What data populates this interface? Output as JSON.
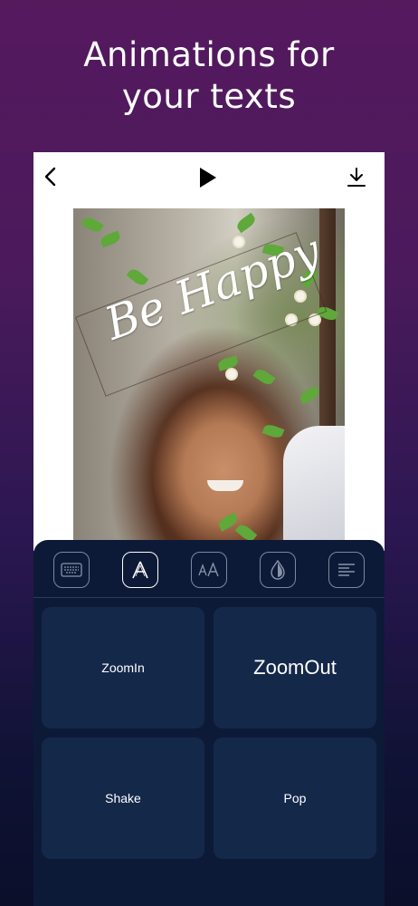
{
  "headline": {
    "line1": "Animations for",
    "line2": "your texts"
  },
  "topbar": {
    "icons": [
      "back-icon",
      "play-icon",
      "download-icon"
    ]
  },
  "canvas": {
    "text": "Be Happy"
  },
  "toolbar": {
    "tools": [
      "keyboard-icon",
      "animation-icon",
      "font-size-icon",
      "color-drop-icon",
      "align-icon"
    ],
    "active": "animation-icon"
  },
  "animations": {
    "items": [
      {
        "label": "ZoomIn"
      },
      {
        "label": "ZoomOut"
      },
      {
        "label": "Shake"
      },
      {
        "label": "Pop"
      }
    ],
    "selected": "ZoomOut"
  },
  "colors": {
    "panel": "#0d1a37",
    "tile": "#14284a",
    "accent": "#ffffff"
  }
}
